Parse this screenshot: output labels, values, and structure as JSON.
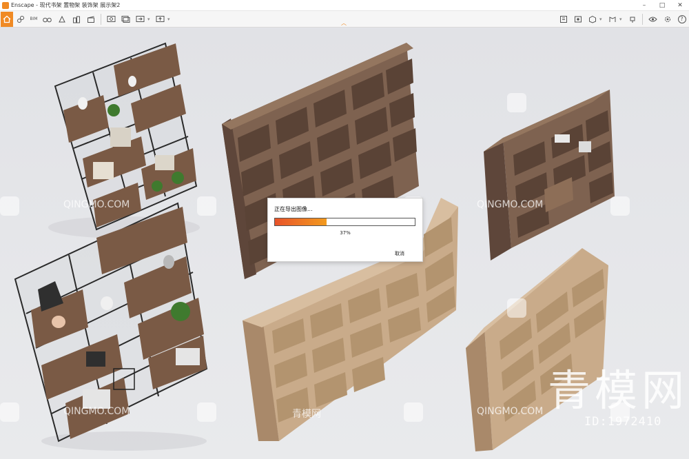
{
  "window": {
    "title": "Enscape - 现代书架 置物架 装饰架 展示架2",
    "minimize_glyph": "–",
    "maximize_glyph": "□",
    "close_glyph": "✕"
  },
  "toolbar": {
    "home_icon": "home-icon",
    "bim_label": "BIM",
    "help_label": "?",
    "accent": "#f08a24"
  },
  "export_dialog": {
    "title": "正在导出图像...",
    "progress": 0.37,
    "percent_text": "37%",
    "cancel_label": "取消",
    "bar_colors": [
      "#e8532a",
      "#f29a1e"
    ]
  },
  "watermarks": {
    "brand": "QINGMO.COM",
    "brand_cn": "青模网",
    "big": "青模网",
    "id_text": "ID:1972410"
  }
}
